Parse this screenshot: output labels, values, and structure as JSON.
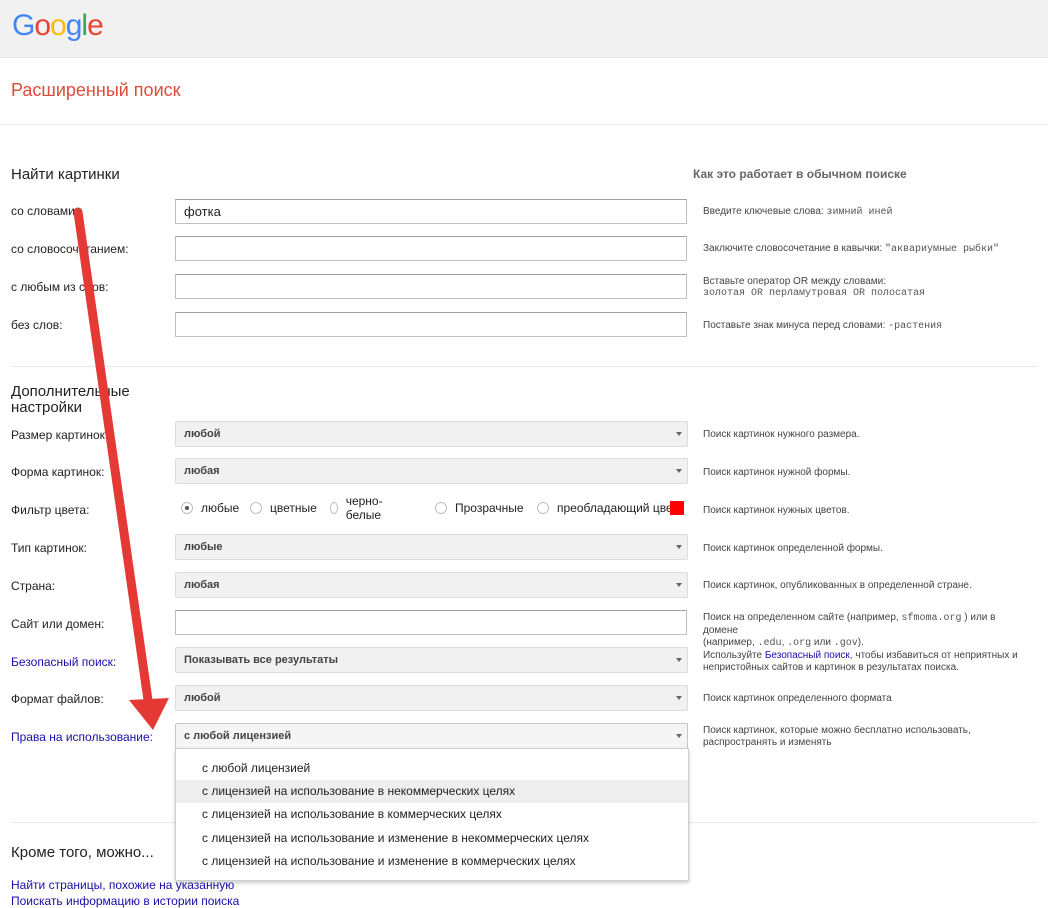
{
  "header": {
    "logo_letters": [
      "G",
      "o",
      "o",
      "g",
      "l",
      "e"
    ],
    "logo_colors": [
      "#4285F4",
      "#EA4335",
      "#FBBC05",
      "#4285F4",
      "#34A853",
      "#EA4335"
    ]
  },
  "page_title": "Расширенный поиск",
  "find": {
    "title": "Найти картинки",
    "help_header": "Как это работает в обычном поиске",
    "rows": [
      {
        "label": "со словами:",
        "value": "фотка",
        "hint_text": "Введите ключевые слова:",
        "hint_example": "зимний иней"
      },
      {
        "label": "со словосочетанием:",
        "value": "",
        "hint_text": "Заключите словосочетание в кавычки:",
        "hint_example": "\"аквариумные рыбки\""
      },
      {
        "label": "с любым из слов:",
        "value": "",
        "hint_line1": "Вставьте оператор OR между словами:",
        "hint_example": "золотая OR перламутровая OR полосатая"
      },
      {
        "label": "без слов:",
        "value": "",
        "hint_text": "Поставьте знак минуса перед словами:",
        "hint_example": "-растения"
      }
    ]
  },
  "more": {
    "title_line1": "Дополнительные",
    "title_line2": "настройки",
    "size": {
      "label": "Размер картинок:",
      "value": "любой",
      "hint": "Поиск картинок нужного размера."
    },
    "aspect": {
      "label": "Форма картинок:",
      "value": "любая",
      "hint": "Поиск картинок нужной формы."
    },
    "color": {
      "label": "Фильтр цвета:",
      "options": [
        "любые",
        "цветные",
        "черно-белые",
        "Прозрачные",
        "преобладающий цвет"
      ],
      "selected_index": 0,
      "swatch_color": "#FF0000",
      "hint": "Поиск картинок нужных цветов."
    },
    "type": {
      "label": "Тип картинок:",
      "value": "любые",
      "hint": "Поиск картинок определенной формы."
    },
    "country": {
      "label": "Страна:",
      "value": "любая",
      "hint": "Поиск картинок, опубликованных в определенной стране."
    },
    "site": {
      "label": "Сайт или домен:",
      "value": "",
      "hint_1": "Поиск на определенном сайте (например,",
      "hint_code1": "sfmoma.org",
      "hint_2": ") или в домене",
      "hint_3": "(например,",
      "hint_code2": ".edu",
      "hint_4": ",",
      "hint_code3": ".org",
      "hint_5": "или",
      "hint_code4": ".gov",
      "hint_6": ")."
    },
    "safe": {
      "label": "Безопасный поиск:",
      "value": "Показывать все результаты",
      "hint_1": "Используйте",
      "hint_link": "Безопасный поиск",
      "hint_2": ", чтобы избавиться от неприятных и",
      "hint_3": "непристойных сайтов и картинок в результатах поиска."
    },
    "filetype": {
      "label": "Формат файлов:",
      "value": "любой",
      "hint": "Поиск картинок определенного формата"
    },
    "rights": {
      "label": "Права на использование:",
      "value": "с любой лицензией",
      "hint_line1": "Поиск картинок, которые можно бесплатно использовать,",
      "hint_line2": "распространять и изменять",
      "options": [
        "с любой лицензией",
        "с лицензией на использование в некоммерческих целях",
        "с лицензией на использование в коммерческих целях",
        "с лицензией на использование и изменение в некоммерческих целях",
        "с лицензией на использование и изменение в коммерческих целях"
      ],
      "hovered_index": 1
    }
  },
  "also": {
    "title": "Кроме того, можно...",
    "links": [
      "Найти страницы, похожие на указанную",
      "Поискать информацию в истории поиска"
    ]
  },
  "annotation_color": "#E53935"
}
